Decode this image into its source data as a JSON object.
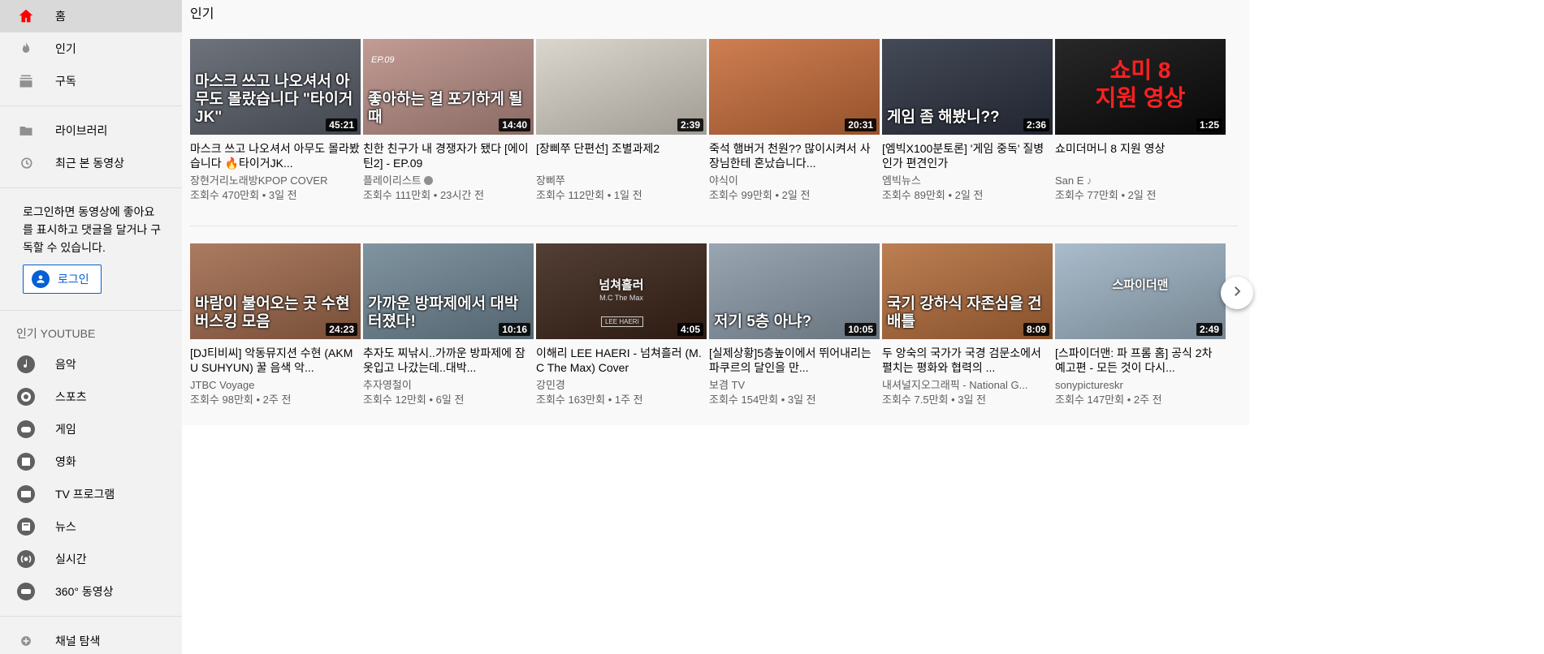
{
  "sidebar": {
    "nav": [
      {
        "label": "홈",
        "icon": "home-icon",
        "active": true
      },
      {
        "label": "인기",
        "icon": "flame-icon"
      },
      {
        "label": "구독",
        "icon": "subscriptions-icon"
      }
    ],
    "library": [
      {
        "label": "라이브러리",
        "icon": "folder-icon"
      },
      {
        "label": "최근 본 동영상",
        "icon": "history-icon"
      }
    ],
    "signin_text": "로그인하면 동영상에 좋아요를 표시하고 댓글을 달거나 구독할 수 있습니다.",
    "signin_button": "로그인",
    "popular_title": "인기 YOUTUBE",
    "popular": [
      {
        "label": "음악",
        "icon": "music-icon"
      },
      {
        "label": "스포츠",
        "icon": "sports-icon"
      },
      {
        "label": "게임",
        "icon": "gaming-icon"
      },
      {
        "label": "영화",
        "icon": "movie-icon"
      },
      {
        "label": "TV 프로그램",
        "icon": "tv-icon"
      },
      {
        "label": "뉴스",
        "icon": "news-icon"
      },
      {
        "label": "실시간",
        "icon": "live-icon"
      },
      {
        "label": "360° 동영상",
        "icon": "vr360-icon"
      }
    ],
    "browse_channels": "채널 탐색"
  },
  "main": {
    "title": "인기",
    "rows": [
      [
        {
          "thumb_text": "마스크 쓰고 나오셔서 아무도 몰랐습니다 \"타이거JK\"",
          "duration": "45:21",
          "title": "마스크 쓰고 나오셔서 아무도 몰라봤습니다 🔥타이거JK...",
          "channel": "장현거리노래방KPOP COVER",
          "meta": "조회수 470만회 • 3일 전",
          "bg": "#5a5f6a"
        },
        {
          "thumb_text": "좋아하는 걸 포기하게 될 때",
          "duration": "14:40",
          "title": "친한 친구가 내 경쟁자가 됐다 [에이틴2] - EP.09",
          "channel": "플레이리스트",
          "verified": true,
          "meta": "조회수 111만회 • 23시간 전",
          "bg": "#b98e86",
          "label_ep": "EP.09"
        },
        {
          "thumb_text": "",
          "duration": "2:39",
          "title": "[장삐쭈 단편선] 조별과제2",
          "channel": "장삐쭈",
          "meta": "조회수 112만회 • 1일 전",
          "bg": "#d6d1c6"
        },
        {
          "thumb_text": "",
          "duration": "20:31",
          "title": "죽석 햄버거 천원?? 많이시켜서 사장님한테 혼났습니다...",
          "channel": "야식이",
          "meta": "조회수 99만회 • 2일 전",
          "bg": "#c86d3a"
        },
        {
          "thumb_text": "게임 좀 해봤니??",
          "duration": "2:36",
          "title": "[엠빅X100분토론] '게임 중독' 질병인가 편견인가",
          "channel": "엠빅뉴스",
          "meta": "조회수 89만회 • 2일 전",
          "bg": "#2b3140"
        },
        {
          "thumb_text": "쇼미 8\n지원 영상",
          "duration": "1:25",
          "title": "쇼미더머니 8 지원 영상",
          "channel": "San E",
          "music_note": true,
          "meta": "조회수 77만회 • 2일 전",
          "bg": "#0a0a0a"
        }
      ],
      [
        {
          "thumb_text": "바람이 불어오는 곳 수현 버스킹 모음",
          "duration": "24:23",
          "title": "[DJ티비씨] 악동뮤지션 수현 (AKMU SUHYUN) 꿀 음색 악...",
          "channel": "JTBC Voyage",
          "meta": "조회수 98만회 • 2주 전",
          "bg": "#a0694b"
        },
        {
          "thumb_text": "가까운 방파제에서 대박 터졌다!",
          "duration": "10:16",
          "title": "추자도 찌낚시..가까운 방파제에 잠옷입고 나갔는데..대박...",
          "channel": "추자영철이",
          "meta": "조회수 12만회 • 6일 전",
          "bg": "#6f8694"
        },
        {
          "thumb_text": "",
          "duration": "4:05",
          "title": "이해리 LEE HAERI - 넘쳐흘러 (M.C The Max) Cover",
          "channel": "강민경",
          "meta": "조회수 163만회 • 1주 전",
          "bg": "#3b2418",
          "overlay_title": "넘쳐흘러",
          "overlay_sub": "M.C The Max",
          "overlay_badge": "LEE HAERI"
        },
        {
          "thumb_text": "저기 5층 아냐?",
          "duration": "10:05",
          "title": "[실제상황]5층높이에서 뛰어내리는 파쿠르의 달인을 만...",
          "channel": "보겸 TV",
          "meta": "조회수 154만회 • 3일 전",
          "bg": "#8b9aa8"
        },
        {
          "thumb_text": "국기 강하식 자존심을 건 배틀",
          "duration": "8:09",
          "title": "두 앙숙의 국가가 국경 검문소에서 펼치는 평화와 협력의 ...",
          "channel": "내셔널지오그래픽 - National G...",
          "meta": "조회수 7.5만회 • 3일 전",
          "bg": "#b46d3b"
        },
        {
          "thumb_text": "",
          "duration": "2:49",
          "title": "[스파이더맨: 파 프롬 홈] 공식 2차 예고편 - 모든 것이 다시...",
          "channel": "sonypictureskr",
          "meta": "조회수 147만회 • 2주 전",
          "bg": "#9eb3c4",
          "overlay_title": "스파이더맨"
        }
      ]
    ]
  }
}
